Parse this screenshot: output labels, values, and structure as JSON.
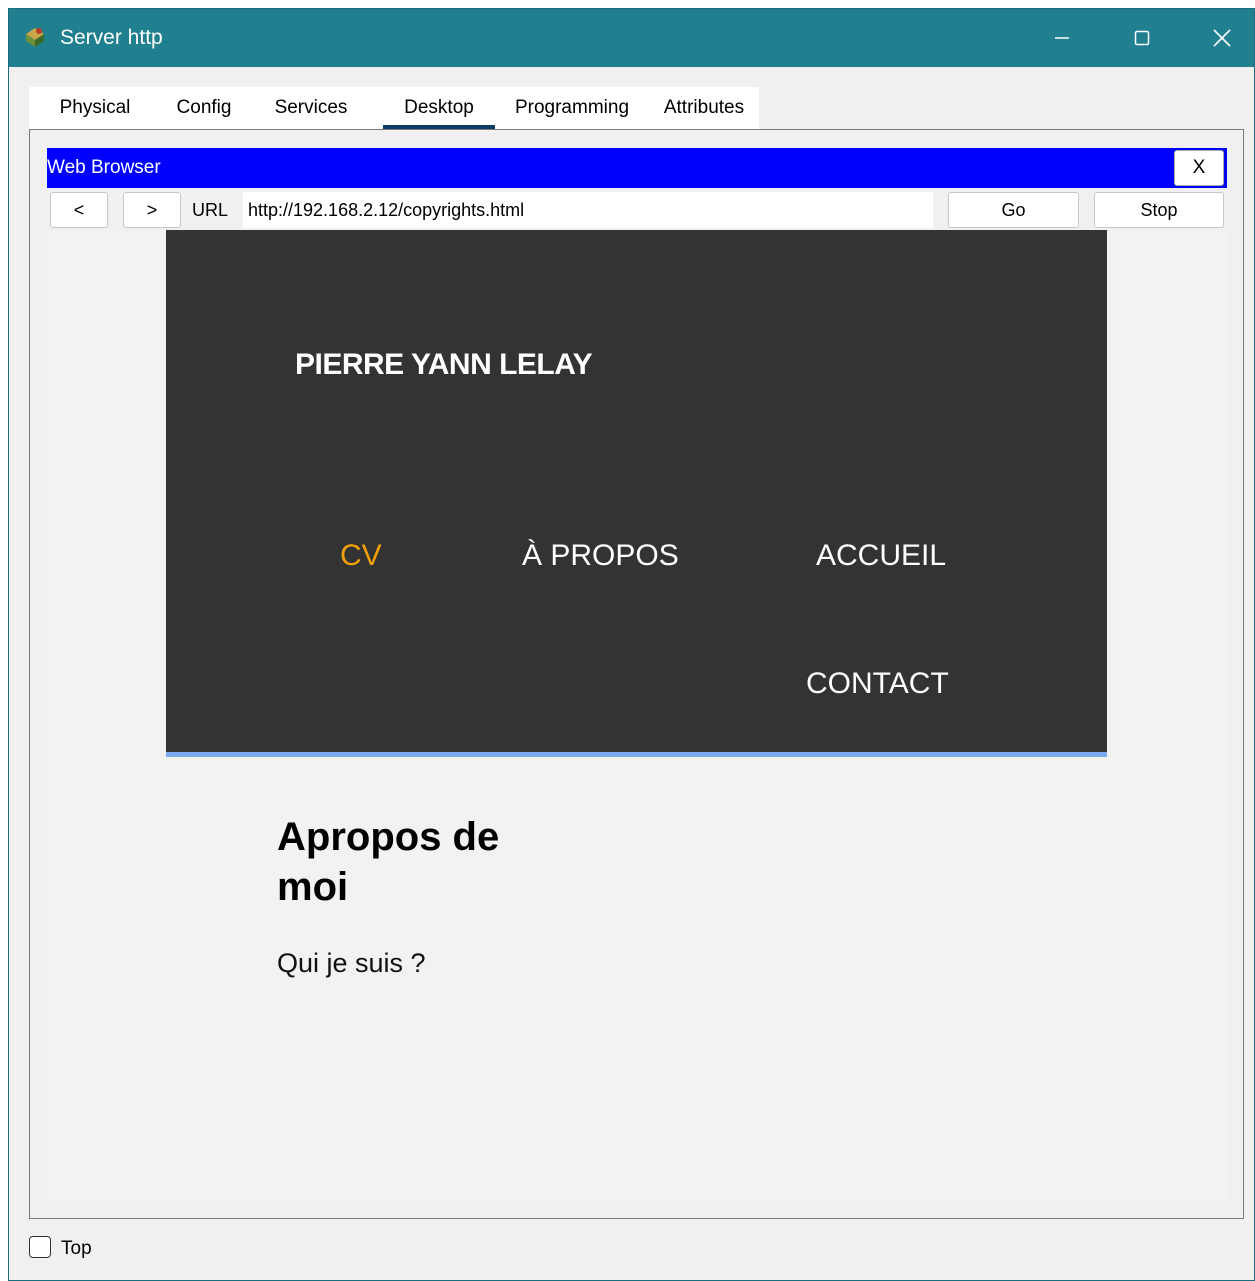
{
  "window": {
    "title": "Server http",
    "app_icon": "packet-tracer-server-icon",
    "controls": [
      "minimize-icon",
      "maximize-icon",
      "close-icon"
    ],
    "titlebar_color": "#21808f"
  },
  "tabs": [
    {
      "label": "Physical",
      "active": false
    },
    {
      "label": "Config",
      "active": false
    },
    {
      "label": "Services",
      "active": false
    },
    {
      "label": "Desktop",
      "active": true
    },
    {
      "label": "Programming",
      "active": false
    },
    {
      "label": "Attributes",
      "active": false
    }
  ],
  "browser": {
    "title": "Web Browser",
    "close_label": "X",
    "back_label": "<",
    "forward_label": ">",
    "url_label": "URL",
    "url_value": "http://192.168.2.12/copyrights.html",
    "go_label": "Go",
    "stop_label": "Stop",
    "title_color": "#0000ff"
  },
  "site": {
    "name": "PIERRE YANN LELAY",
    "nav": [
      {
        "label": "CV",
        "active": true
      },
      {
        "label": "À PROPOS",
        "active": false
      },
      {
        "label": "ACCUEIL",
        "active": false
      },
      {
        "label": "CONTACT",
        "active": false
      }
    ],
    "header_bg": "#333333",
    "accent": "#f2a007",
    "about_title": "Apropos de moi",
    "about_subtitle": "Qui je suis ?"
  },
  "footer": {
    "top_checkbox_label": "Top",
    "top_checked": false
  }
}
